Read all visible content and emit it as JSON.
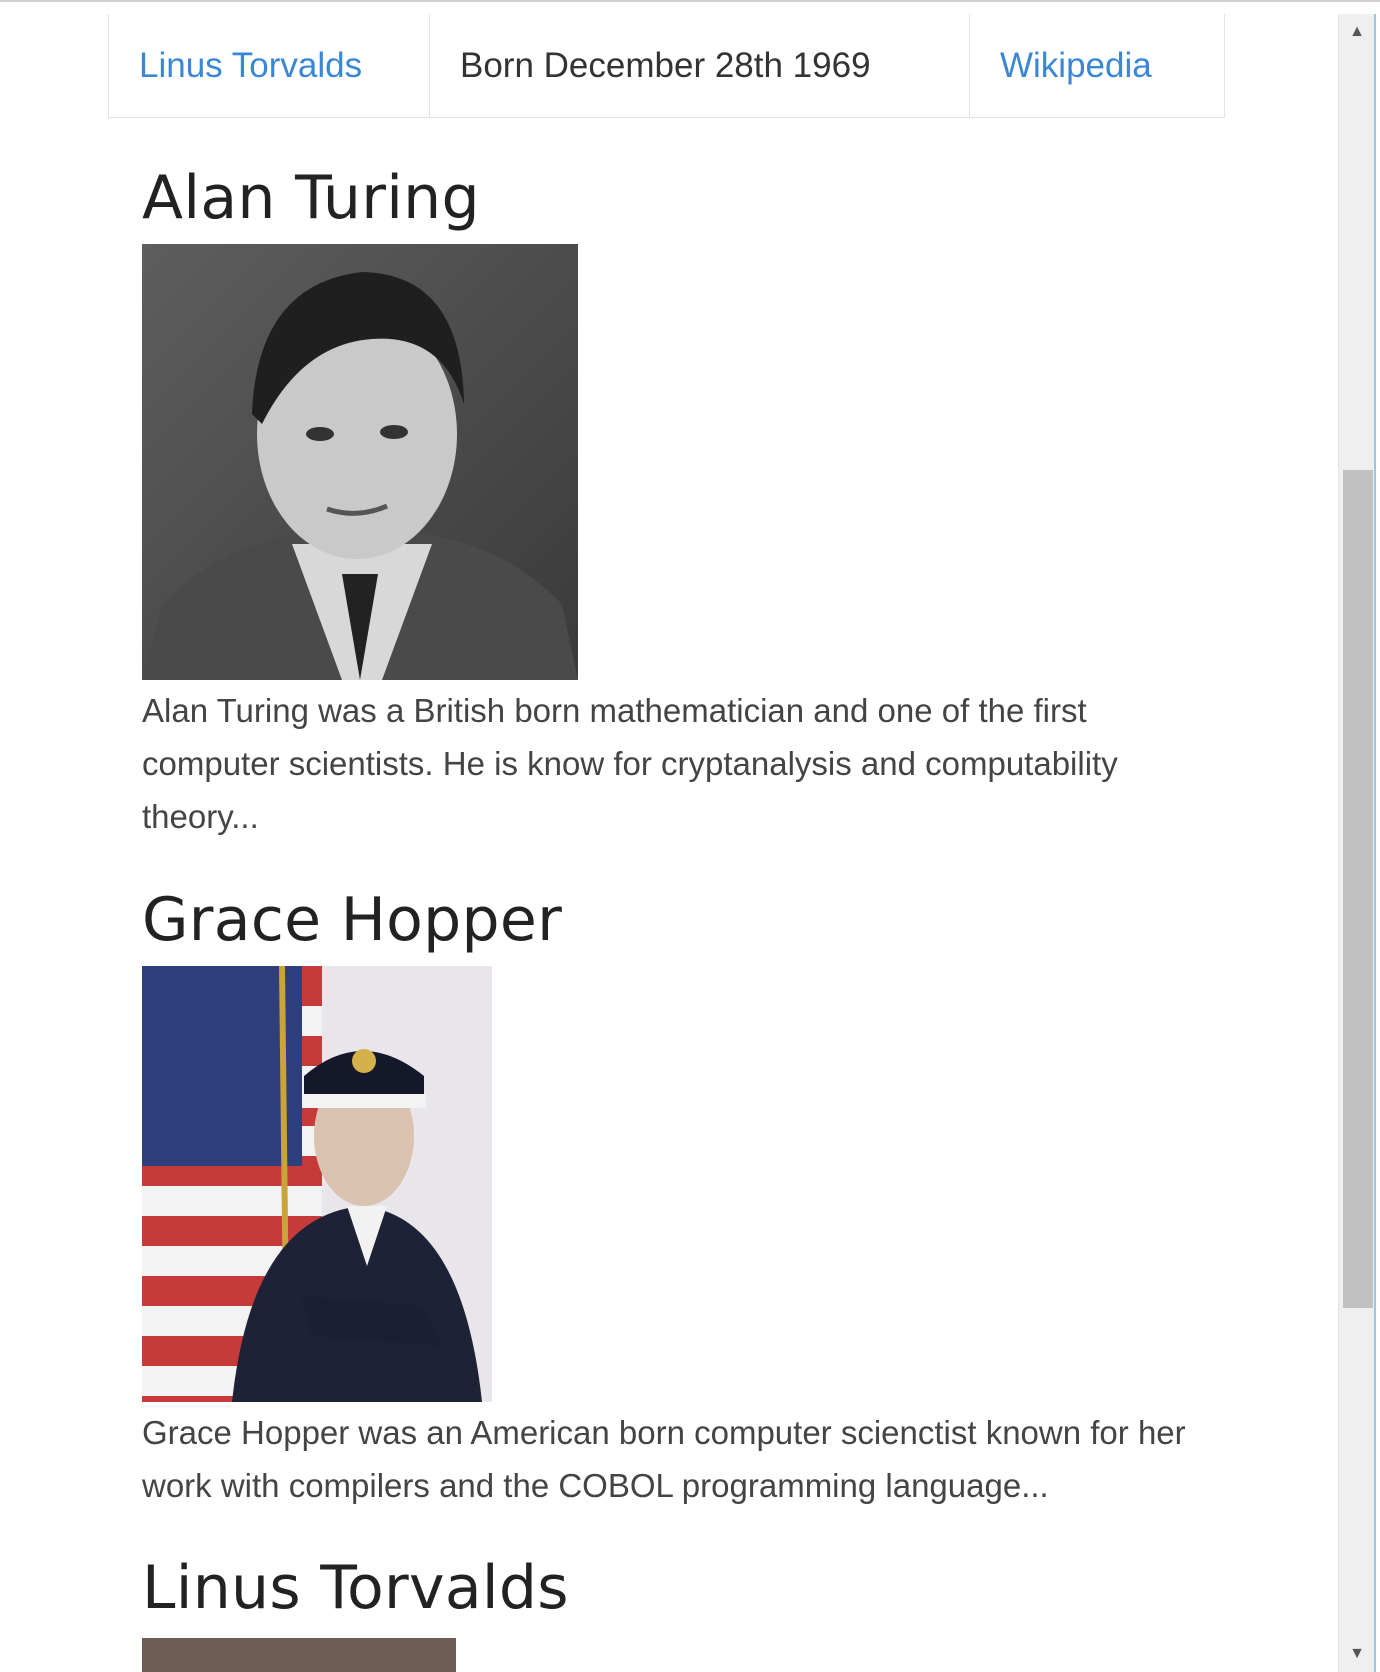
{
  "table_row": {
    "name_link": "Linus Torvalds",
    "born": "Born December 28th 1969",
    "wiki_link": "Wikipedia"
  },
  "people": [
    {
      "name": "Alan Turing",
      "description": "Alan Turing was a British born mathematician and one of the first computer scientists. He is know for cryptanalysis and computability theory..."
    },
    {
      "name": "Grace Hopper",
      "description": "Grace Hopper was an American born computer scienctist known for her work with compilers and the COBOL programming language..."
    },
    {
      "name": "Linus Torvalds",
      "description": ""
    }
  ],
  "icons": {
    "scroll_up": "scroll-up-arrow-icon",
    "scroll_down": "scroll-down-arrow-icon"
  }
}
